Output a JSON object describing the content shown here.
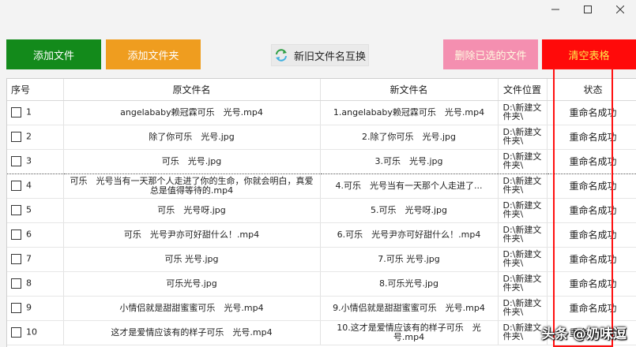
{
  "window": {
    "controls": [
      "minimize-icon",
      "maximize-icon",
      "close-icon"
    ]
  },
  "toolbar": {
    "add_file": "添加文件",
    "add_folder": "添加文件夹",
    "swap_names": "新旧文件名互换",
    "delete_selected": "删除已选的文件",
    "clear_table": "清空表格",
    "colors": {
      "add_file": "#138a1b",
      "add_folder": "#ef9d1f",
      "delete_selected": "#f48fb0",
      "clear_table": "#ff0a0a"
    }
  },
  "table": {
    "headers": {
      "index": "序号",
      "original": "原文件名",
      "new": "新文件名",
      "location": "文件位置",
      "status": "状态"
    },
    "rows": [
      {
        "index": "1",
        "original": "angelababy赖冠霖可乐　光号.mp4",
        "new": "1.angelababy赖冠霖可乐　光号.mp4",
        "location": "D:\\新建文件夹\\",
        "status": "重命名成功"
      },
      {
        "index": "2",
        "original": "除了你可乐　光号.jpg",
        "new": "2.除了你可乐　光号.jpg",
        "location": "D:\\新建文件夹\\",
        "status": "重命名成功"
      },
      {
        "index": "3",
        "original": "可乐　光号.jpg",
        "new": "3.可乐　光号.jpg",
        "location": "D:\\新建文件夹\\",
        "status": "重命名成功"
      },
      {
        "index": "4",
        "original": "可乐　光号当有一天那个人走进了你的生命，你就会明白，真爱总是值得等待的.mp4",
        "new": "4.可乐　光号当有一天那个人走进了...",
        "location": "D:\\新建文件夹\\",
        "status": "重命名成功"
      },
      {
        "index": "5",
        "original": "可乐　光号呀.jpg",
        "new": "5.可乐　光号呀.jpg",
        "location": "D:\\新建文件夹\\",
        "status": "重命名成功"
      },
      {
        "index": "6",
        "original": "可乐　光号尹亦可好甜什么！.mp4",
        "new": "6.可乐　光号尹亦可好甜什么！.mp4",
        "location": "D:\\新建文件夹\\",
        "status": "重命名成功"
      },
      {
        "index": "7",
        "original": "可乐 光号.jpg",
        "new": "7.可乐 光号.jpg",
        "location": "D:\\新建文件夹\\",
        "status": "重命名成功"
      },
      {
        "index": "8",
        "original": "可乐光号.jpg",
        "new": "8.可乐光号.jpg",
        "location": "D:\\新建文件夹\\",
        "status": "重命名成功"
      },
      {
        "index": "9",
        "original": "小情侣就是甜甜蜜蜜可乐　光号.mp4",
        "new": "9.小情侣就是甜甜蜜蜜可乐　光号.mp4",
        "location": "D:\\新建文件夹\\",
        "status": "重命名成功"
      },
      {
        "index": "10",
        "original": "这才是爱情应该有的样子可乐　光号.mp4",
        "new": "10.这才是爱情应该有的样子可乐　光号.mp4",
        "location": "D:\\新建文件夹\\",
        "status": "重命名成功"
      }
    ]
  },
  "watermark": "头条 @奶味逗"
}
